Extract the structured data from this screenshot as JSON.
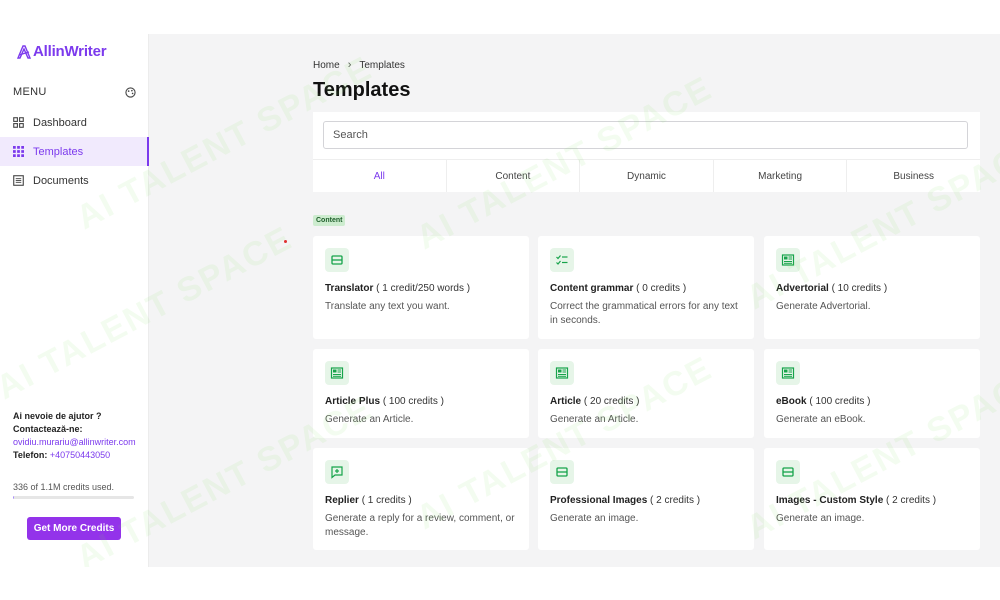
{
  "app": {
    "logo_text": "AllinWriter"
  },
  "sidebar": {
    "menu_label": "MENU",
    "items": [
      {
        "label": "Dashboard",
        "icon": "dashboard-icon",
        "active": false
      },
      {
        "label": "Templates",
        "icon": "grid-icon",
        "active": true
      },
      {
        "label": "Documents",
        "icon": "document-icon",
        "active": false
      }
    ],
    "help": {
      "question": "Ai nevoie de ajutor ?",
      "contact_label": "Contactează-ne",
      "email": "ovidiu.murariu@allinwriter.com",
      "phone_label": "Telefon",
      "phone": "+40750443050"
    },
    "credits_text": "336 of 1.1M credits used.",
    "credits_fraction": 0.0003,
    "cta_label": "Get More Credits"
  },
  "main": {
    "breadcrumb": {
      "home": "Home",
      "current": "Templates"
    },
    "title": "Templates",
    "search": {
      "placeholder": "Search",
      "value": ""
    },
    "tabs": [
      {
        "label": "All",
        "active": true
      },
      {
        "label": "Content",
        "active": false
      },
      {
        "label": "Dynamic",
        "active": false
      },
      {
        "label": "Marketing",
        "active": false
      },
      {
        "label": "Business",
        "active": false
      }
    ],
    "section_label": "Content",
    "cards": [
      {
        "name": "Translator",
        "credits": "( 1 credit/250 words )",
        "desc": "Translate any text you want.",
        "icon": "list-icon"
      },
      {
        "name": "Content grammar",
        "credits": "( 0 credits )",
        "desc": "Correct the grammatical errors for any text in seconds.",
        "icon": "checklist-icon"
      },
      {
        "name": "Advertorial",
        "credits": "( 10 credits )",
        "desc": "Generate Advertorial.",
        "icon": "article-icon"
      },
      {
        "name": "Article Plus",
        "credits": "( 100 credits )",
        "desc": "Generate an Article.",
        "icon": "article-icon"
      },
      {
        "name": "Article",
        "credits": "( 20 credits )",
        "desc": "Generate an Article.",
        "icon": "article-icon"
      },
      {
        "name": "eBook",
        "credits": "( 100 credits )",
        "desc": "Generate an eBook.",
        "icon": "article-icon"
      },
      {
        "name": "Replier",
        "credits": "( 1 credits )",
        "desc": "Generate a reply for a review, comment, or message.",
        "icon": "reply-icon"
      },
      {
        "name": "Professional Images",
        "credits": "( 2 credits )",
        "desc": "Generate an image.",
        "icon": "list-icon"
      },
      {
        "name": "Images - Custom Style",
        "credits": "( 2 credits )",
        "desc": "Generate an image.",
        "icon": "list-icon"
      }
    ]
  },
  "watermark": "AI TALENT SPACE",
  "colors": {
    "accent": "#7c3aed",
    "button": "#9333ea",
    "icon_green": "#16a34a",
    "icon_bg": "#e6f5e8"
  }
}
